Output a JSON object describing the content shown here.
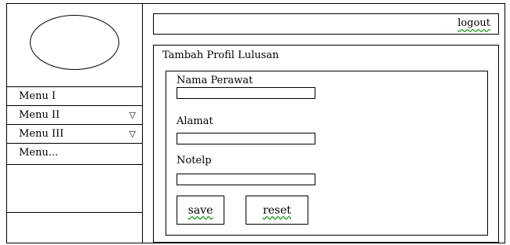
{
  "sidebar": {
    "items": [
      {
        "label": "Menu I",
        "has_dropdown": false
      },
      {
        "label": "Menu II",
        "has_dropdown": true,
        "arrow": "▽"
      },
      {
        "label": "Menu III",
        "has_dropdown": true,
        "arrow": "▽"
      },
      {
        "label": "Menu...",
        "has_dropdown": false
      }
    ]
  },
  "topbar": {
    "logout_label": "logout"
  },
  "panel": {
    "title": "Tambah Profil Lulusan",
    "fields": [
      {
        "label": "Nama Perawat",
        "value": "",
        "placeholder": ""
      },
      {
        "label": "Alamat",
        "value": "",
        "placeholder": ""
      },
      {
        "label": "Notelp",
        "value": "",
        "placeholder": ""
      }
    ],
    "save_label": "save",
    "reset_label": "reset"
  },
  "colors": {
    "border": "#000000",
    "background": "#ffffff",
    "spellcheck_underline": "#2aa02a"
  }
}
